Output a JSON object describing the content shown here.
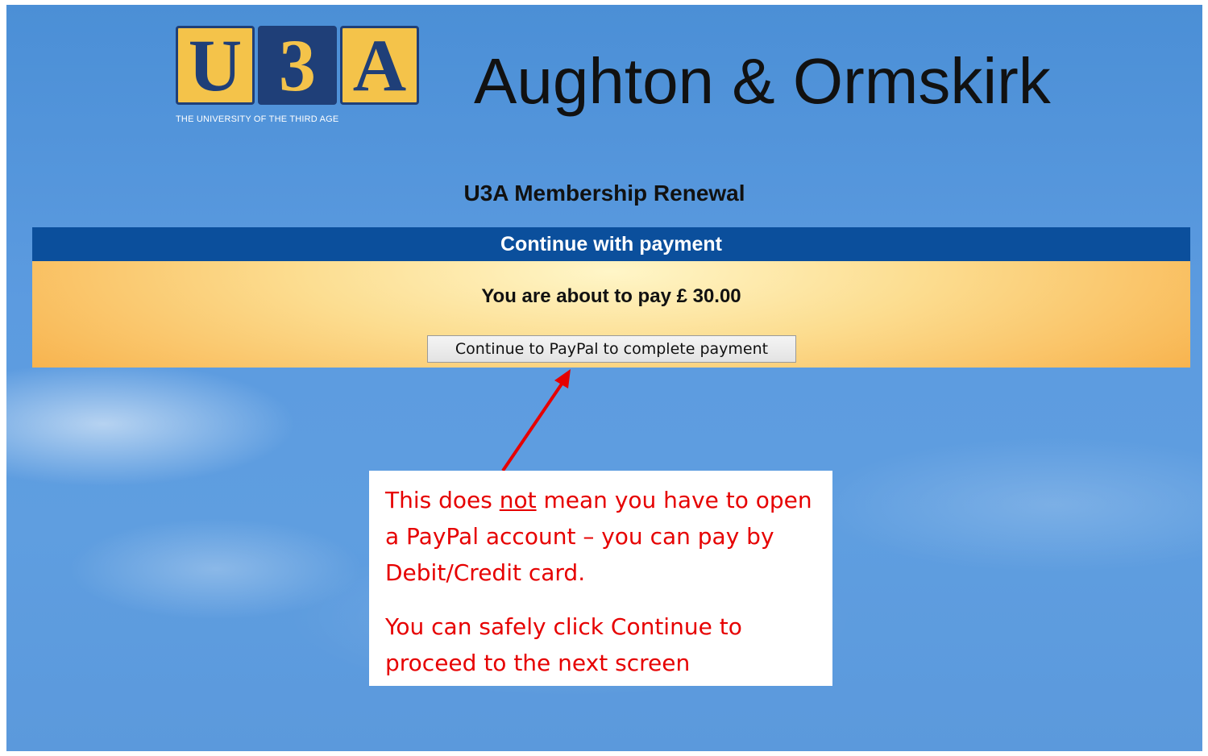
{
  "logo": {
    "letters": [
      "U",
      "3",
      "A"
    ],
    "tagline": "THE UNIVERSITY OF THE THIRD AGE"
  },
  "header": {
    "site_title": "Aughton & Ormskirk"
  },
  "page": {
    "heading": "U3A Membership Renewal"
  },
  "panel": {
    "title": "Continue with payment",
    "amount_text": "You are about to pay £ 30.00",
    "button_label": "Continue to PayPal to complete payment"
  },
  "callout": {
    "line1_before": "This does ",
    "line1_emph": "not",
    "line1_after": " mean you have to open a PayPal account – you can pay by Debit/Credit card.",
    "line2": "You can safely click Continue to proceed to the next screen"
  },
  "colors": {
    "header_bar": "#0b4f9c",
    "logo_yellow": "#f4c34a",
    "logo_blue": "#1f3f78",
    "callout_text": "#e60000",
    "arrow": "#e60000"
  },
  "icons": {
    "annotation_arrow": "arrow-up-icon"
  }
}
